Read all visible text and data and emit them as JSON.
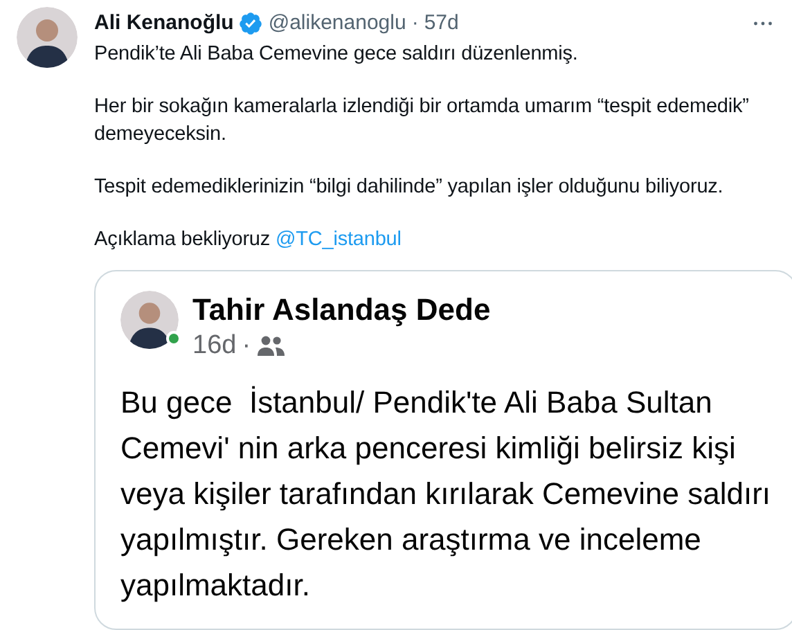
{
  "tweet": {
    "author": {
      "name": "Ali Kenanoğlu",
      "verified": true,
      "handle": "@alikenanoglu",
      "separator": "·",
      "time": "57d"
    },
    "paragraphs": [
      {
        "text": "Pendik’te Ali Baba Cemevine gece saldırı düzenlenmiş."
      },
      {
        "text": "Her bir sokağın kameralarla izlendiği bir ortamda umarım “tespit edemedik” demeyeceksin."
      },
      {
        "text": "Tespit edemediklerinizin “bilgi dahilinde” yapılan işler olduğunu biliyoruz."
      },
      {
        "text": "Açıklama bekliyoruz",
        "mention": "@TC_istanbul"
      }
    ],
    "embedded_post": {
      "author": "Tahir Aslandaş Dede",
      "online": true,
      "time": "16d",
      "separator": "·",
      "body": "Bu gece  İstanbul/ Pendik'te Ali Baba Sultan Cemevi' nin arka penceresi kimliği belirsiz kişi veya kişiler tarafından kırılarak Cemevine saldırı yapılmıştır. Gereken araştırma ve inceleme yapılmaktadır."
    }
  }
}
